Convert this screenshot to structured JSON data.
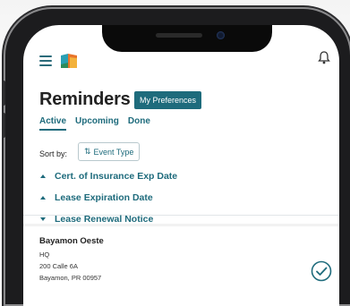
{
  "header": {
    "menu_icon": "hamburger-menu-icon",
    "logo_icon": "app-logo-icon",
    "bell_icon": "bell-icon"
  },
  "page": {
    "title": "Reminders",
    "preferences_button": "My Preferences"
  },
  "tabs": [
    {
      "label": "Active",
      "active": true
    },
    {
      "label": "Upcoming",
      "active": false
    },
    {
      "label": "Done",
      "active": false
    }
  ],
  "sort": {
    "label": "Sort by:",
    "button_label": "Event Type",
    "button_icon": "sort-icon"
  },
  "groups": [
    {
      "label": "Cert. of Insurance Exp Date",
      "expanded": false
    },
    {
      "label": "Lease Expiration Date",
      "expanded": false
    },
    {
      "label": "Lease Renewal Notice",
      "expanded": true
    }
  ],
  "reminder_item": {
    "name": "Bayamon Oeste",
    "lines": [
      "HQ",
      "200 Calle 6A",
      "Bayamon, PR 00957"
    ],
    "check_icon": "check-circle-icon"
  },
  "colors": {
    "accent": "#1e6b7c",
    "text": "#222222",
    "phone_frame": "#1c1c1e"
  }
}
